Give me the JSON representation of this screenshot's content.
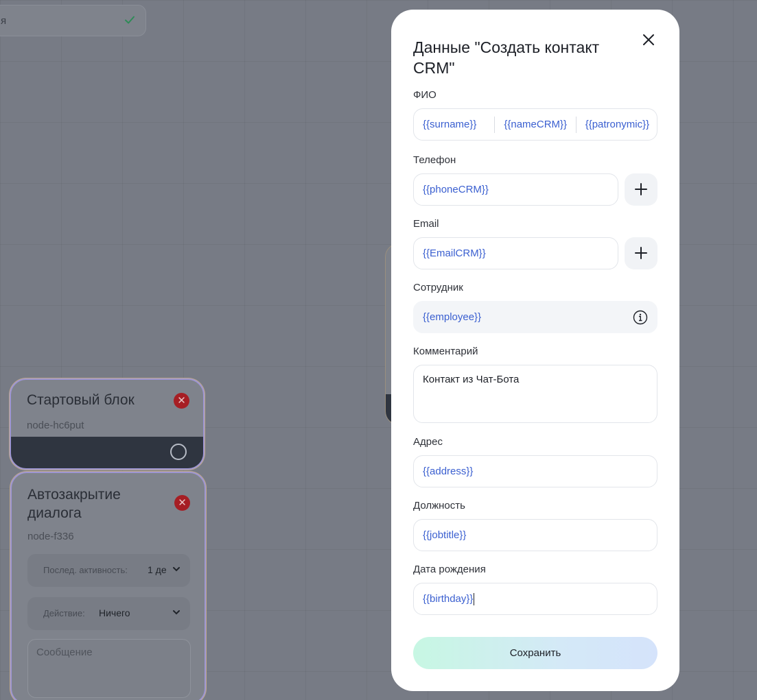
{
  "canvas": {
    "top_node": {
      "text": "я"
    },
    "start_node": {
      "title": "Стартовый блок",
      "id": "node-hc6put"
    },
    "auto_close_node": {
      "title": "Автозакрытие диалога",
      "id": "node-f336",
      "activity_label": "Послед. активность:",
      "activity_value": "1 де",
      "action_label": "Действие:",
      "action_value": "Ничего",
      "message_placeholder": "Сообщение"
    }
  },
  "modal": {
    "title": "Данные \"Создать контакт CRM\"",
    "fio": {
      "label": "ФИО",
      "surname": "{{surname}}",
      "name": "{{nameCRM}}",
      "patronymic": "{{patronymic}}"
    },
    "phone": {
      "label": "Телефон",
      "value": "{{phoneCRM}}"
    },
    "email": {
      "label": "Email",
      "value": "{{EmailCRM}}"
    },
    "employee": {
      "label": "Сотрудник",
      "value": "{{employee}}"
    },
    "comment": {
      "label": "Комментарий",
      "value": "Контакт из Чат-Бота"
    },
    "address": {
      "label": "Адрес",
      "value": "{{address}}"
    },
    "jobtitle": {
      "label": "Должность",
      "value": "{{jobtitle}}"
    },
    "birthday": {
      "label": "Дата рождения",
      "value": "{{birthday}}"
    },
    "save_label": "Сохранить"
  },
  "colors": {
    "accent_text": "#3a5fd0",
    "overlay": "#777b85",
    "remove": "#a61e24",
    "success": "#2e8b57"
  }
}
